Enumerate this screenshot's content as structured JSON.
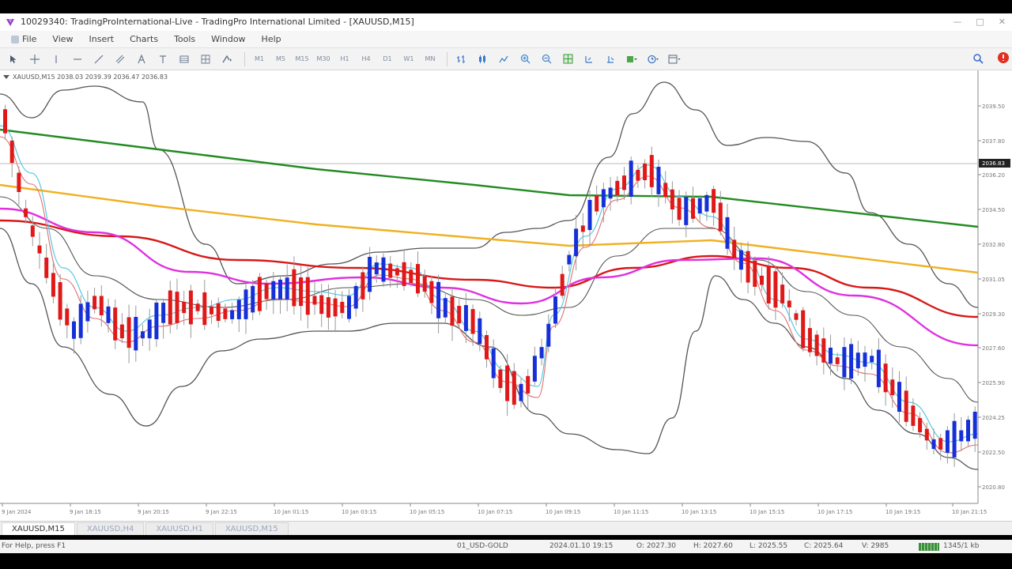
{
  "window": {
    "title": "10029340: TradingProInternational-Live - TradingPro International Limited - [XAUUSD,M15]",
    "controls": [
      "—",
      "□",
      "✕"
    ]
  },
  "menu": {
    "items": [
      "File",
      "View",
      "Insert",
      "Charts",
      "Tools",
      "Window",
      "Help"
    ]
  },
  "toolbar": {
    "timeframes": [
      "M1",
      "M5",
      "M15",
      "M30",
      "H1",
      "H4",
      "D1",
      "W1",
      "MN"
    ],
    "icons": [
      "cursor-icon",
      "crosshair-icon",
      "vertical-line-icon",
      "horizontal-line-icon",
      "trendline-icon",
      "channel-icon",
      "text-icon",
      "label-icon",
      "fibonacci-icon",
      "arrows-icon",
      "bar-chart-icon",
      "candlestick-icon",
      "line-chart-icon",
      "zoom-in-icon",
      "zoom-out-icon",
      "tile-icon",
      "scroll-icon",
      "shift-icon",
      "indicators-icon",
      "periods-icon",
      "templates-icon",
      "search-icon",
      "alert-icon"
    ]
  },
  "chart_header": "XAUUSD,M15  2038.03 2039.39 2036.47 2036.83",
  "colors": {
    "bull": "#1530d8",
    "bear": "#e01818",
    "ma_green": "#228b22",
    "ma_orange": "#f0b020",
    "ma_red": "#d81818",
    "ma_magenta": "#e030e0",
    "band": "#555555"
  },
  "price_axis": {
    "ticks": [
      "2039.50",
      "2037.80",
      "2036.20",
      "2034.50",
      "2032.80",
      "2031.05",
      "2029.30",
      "2027.60",
      "2025.90",
      "2024.25",
      "2022.50",
      "2020.80"
    ],
    "current": "2036.83"
  },
  "time_axis": {
    "ticks": [
      "9 Jan 2024",
      "9 Jan 18:15",
      "9 Jan 20:15",
      "9 Jan 22:15",
      "10 Jan 01:15",
      "10 Jan 03:15",
      "10 Jan 05:15",
      "10 Jan 07:15",
      "10 Jan 09:15",
      "10 Jan 11:15",
      "10 Jan 13:15",
      "10 Jan 15:15",
      "10 Jan 17:15",
      "10 Jan 19:15",
      "10 Jan 21:15"
    ]
  },
  "tabs": [
    "XAUUSD,M15",
    "XAUUSD,H4",
    "XAUUSD,H1",
    "XAUUSD,M15"
  ],
  "status": {
    "help": "For Help, press F1",
    "profile": "01_USD-GOLD",
    "datetime": "2024.01.10 19:15",
    "open": "O: 2027.30",
    "high": "H: 2027.60",
    "low": "L: 2025.55",
    "close": "C: 2025.64",
    "volume": "V: 2985",
    "traffic": "1345/1 kb"
  }
}
